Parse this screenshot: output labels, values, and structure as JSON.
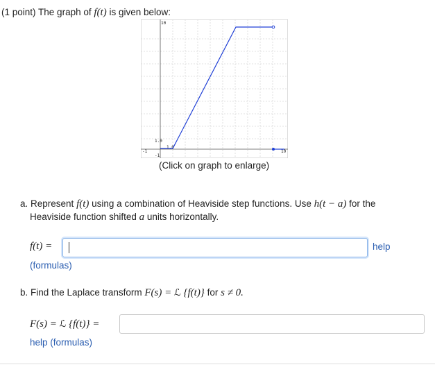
{
  "problem": {
    "points": "(1 point)",
    "intro_text": "The graph of",
    "fn": "f(t)",
    "intro_suffix": "is given below:"
  },
  "graph": {
    "caption": "(Click on graph to enlarge)",
    "tick_labels": {
      "y_top": "10",
      "y_one": "1.0",
      "x_one": "1.0",
      "x_neg": "-1",
      "y_neg": "-1",
      "x_right": "10"
    },
    "line_color": "#1f3fd6"
  },
  "part_a": {
    "prefix": "a. Represent",
    "fn": "f(t)",
    "text1": "using a combination of Heaviside step functions. Use",
    "h": "h(t − a)",
    "text2": "for the",
    "line2_text1": "Heaviside function shifted",
    "a": "a",
    "line2_text2": "units horizontally.",
    "answer_label": "f(t) =",
    "answer_value": "",
    "help_label": "help",
    "formulas_label": "(formulas)"
  },
  "part_b": {
    "prefix": "b. Find the Laplace transform",
    "F": "F(s) = ",
    "L": "ℒ",
    "braces": "{f(t)}",
    "for_text": "for",
    "cond": "s ≠ 0.",
    "answer_label_F": "F(s) = ",
    "answer_label_L": "ℒ",
    "answer_label_rest": "{f(t)} =",
    "answer_value": "",
    "help_label": "help",
    "formulas_label": "(formulas)"
  }
}
